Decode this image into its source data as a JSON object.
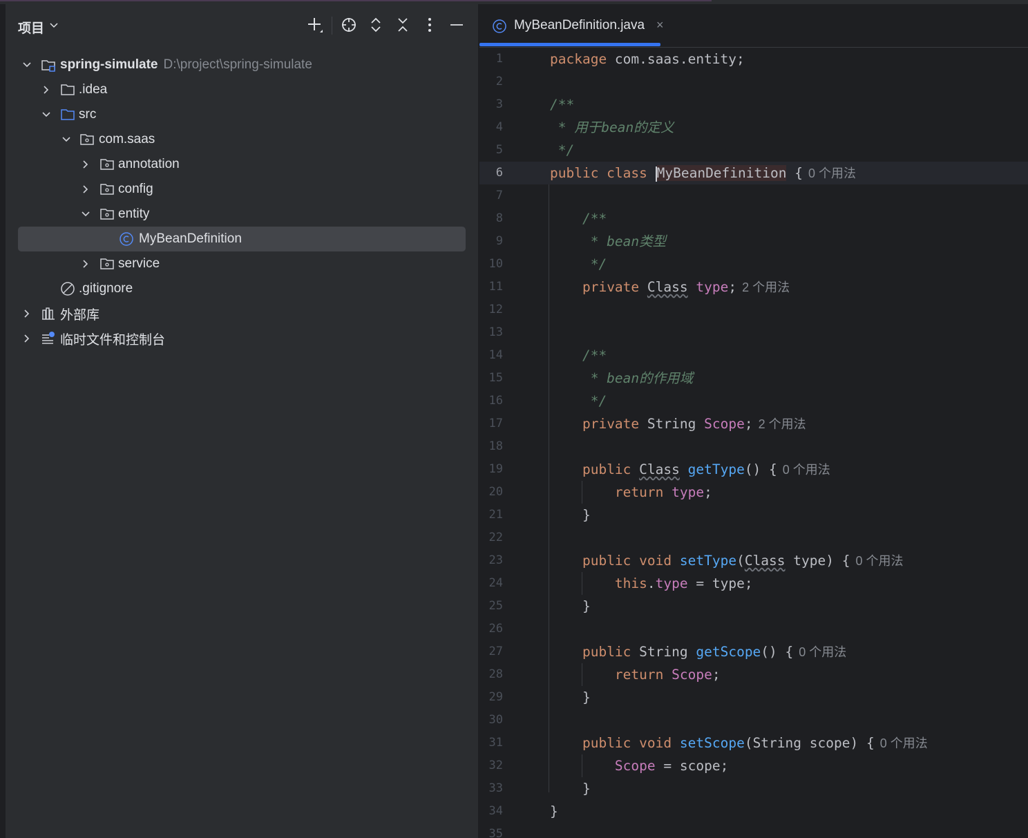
{
  "project_panel": {
    "title": "项目",
    "tree": [
      {
        "label": "spring-simulate",
        "path": "D:\\project\\spring-simulate"
      },
      {
        "label": ".idea"
      },
      {
        "label": "src"
      },
      {
        "label": "com.saas"
      },
      {
        "label": "annotation"
      },
      {
        "label": "config"
      },
      {
        "label": "entity"
      },
      {
        "label": "MyBeanDefinition"
      },
      {
        "label": "service"
      },
      {
        "label": ".gitignore"
      },
      {
        "label": "外部库"
      },
      {
        "label": "临时文件和控制台"
      }
    ]
  },
  "editor": {
    "tab": {
      "name": "MyBeanDefinition.java",
      "close": "×"
    },
    "hints": {
      "usage0": "0 个用法",
      "usage2": "2 个用法"
    },
    "code": {
      "l1": "package",
      "l1b": " com.saas.entity;",
      "l3": "/**",
      "l4": " * 用于bean的定义",
      "l5": " */",
      "l6a": "public class ",
      "l6b": "MyBeanDefinition",
      "l6c": " {",
      "l8": "    /**",
      "l9": "     * bean类型",
      "l10": "     */",
      "kw_private": "private",
      "t_Class": "Class",
      "t_String": "String",
      "f_type": "type",
      "f_Scope": "Scope",
      "l15": "     * bean的作用域",
      "kw_public": "public",
      "kw_void": "void",
      "kw_return": "return",
      "kw_this": "this",
      "m_getType": "getType",
      "m_setType": "setType",
      "m_getScope": "getScope",
      "m_setScope": "setScope",
      "p_type": "type",
      "p_scope": "scope",
      "close_brace": "}"
    },
    "line_numbers": [
      "1",
      "2",
      "3",
      "4",
      "5",
      "6",
      "7",
      "8",
      "9",
      "10",
      "11",
      "12",
      "13",
      "14",
      "15",
      "16",
      "17",
      "18",
      "19",
      "20",
      "21",
      "22",
      "23",
      "24",
      "25",
      "26",
      "27",
      "28",
      "29",
      "30",
      "31",
      "32",
      "33",
      "34",
      "35"
    ]
  },
  "colors": {
    "accent": "#3574f0",
    "keyword": "#cf8e6d",
    "field": "#c77dbb",
    "method": "#56a8f5",
    "comment": "#5f826b"
  }
}
